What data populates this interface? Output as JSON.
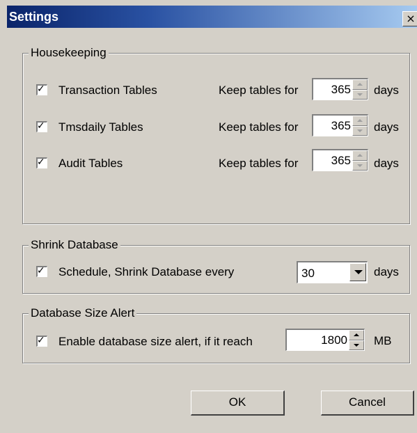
{
  "window": {
    "title": "Settings",
    "close_glyph": "×"
  },
  "housekeeping": {
    "legend": "Housekeeping",
    "rows": [
      {
        "checked": true,
        "label": "Transaction Tables",
        "keep_label": "Keep tables for",
        "value": "365",
        "unit": "days"
      },
      {
        "checked": true,
        "label": "Tmsdaily Tables",
        "keep_label": "Keep tables for",
        "value": "365",
        "unit": "days"
      },
      {
        "checked": true,
        "label": "Audit Tables",
        "keep_label": "Keep tables for",
        "value": "365",
        "unit": "days"
      }
    ]
  },
  "shrink": {
    "legend": "Shrink Database",
    "checked": true,
    "label": "Schedule, Shrink Database every",
    "selected": "30",
    "unit": "days"
  },
  "size_alert": {
    "legend": "Database Size Alert",
    "checked": true,
    "label": "Enable database size alert, if it reach",
    "value": "1800",
    "unit": "MB"
  },
  "buttons": {
    "ok": "OK",
    "cancel": "Cancel"
  },
  "colors": {
    "titlebar_start": "#0a246a",
    "titlebar_end": "#a6caf0",
    "face": "#d4d0c8"
  }
}
